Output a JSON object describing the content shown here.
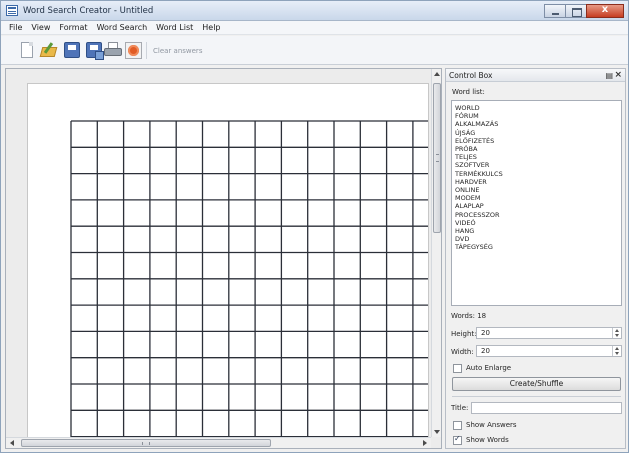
{
  "window": {
    "title": "Word Search Creator - Untitled"
  },
  "menu": [
    "File",
    "View",
    "Format",
    "Word Search",
    "Word List",
    "Help"
  ],
  "toolbar": {
    "icons": [
      "new-file-icon",
      "open-folder-icon",
      "save-icon",
      "save-as-icon",
      "print-icon",
      "stop-icon"
    ],
    "clear_answers_label": "Clear answers"
  },
  "grid": {
    "rows": 20,
    "cols": 20
  },
  "control_box": {
    "title": "Control Box",
    "word_list_label": "Word list:",
    "words": [
      "WORLD",
      "FÓRUM",
      "ALKALMAZÁS",
      "ÚJSÁG",
      "ELŐFIZETÉS",
      "PRÓBA",
      "TELJES",
      "SZOFTVER",
      "TERMÉKKULCS",
      "HARDVER",
      "ONLINE",
      "MODEM",
      "ALAPLAP",
      "PROCESSZOR",
      "VIDEÓ",
      "HANG",
      "DVD",
      "TÁPEGYSÉG"
    ],
    "words_count_label": "Words: 18",
    "height_label": "Height:",
    "height_value": "20",
    "width_label": "Width:",
    "width_value": "20",
    "auto_enlarge_label": "Auto Enlarge",
    "auto_enlarge_checked": false,
    "create_button_label": "Create/Shuffle",
    "title_label": "Title:",
    "title_value": "",
    "show_answers_label": "Show Answers",
    "show_answers_checked": false,
    "show_words_label": "Show Words",
    "show_words_checked": true
  }
}
